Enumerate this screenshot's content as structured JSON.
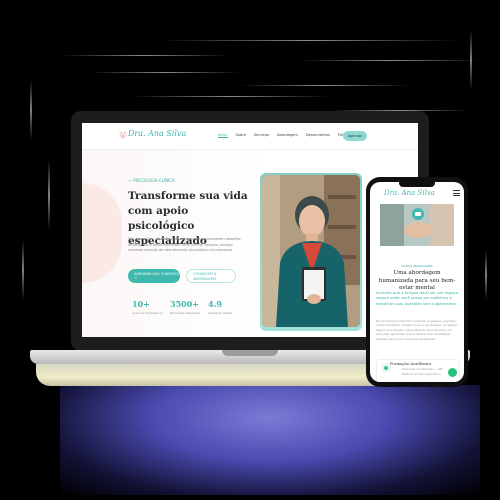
{
  "laptop_site": {
    "logo": "Dra. Ana Silva",
    "nav": {
      "items": [
        "Início",
        "Sobre",
        "Serviços",
        "Abordagem",
        "Depoimentos",
        "FAQ"
      ],
      "cta": "Agendar"
    },
    "hero": {
      "eyebrow": "— PSICOLOGIA CLÍNICA",
      "title": "Transforme sua vida com apoio psicológico especializado",
      "text": "Olá, sou a Dra. Ana Silva. Ajudo pessoas a superarem desafios emocionais e desenvolverem uma melhor relação consigo mesmas através de atendimento psicológico humanizado.",
      "primary_button": "AGENDAR SUA CONSULTA →",
      "secondary_button": "CONHECER A ABORDAGEM"
    },
    "stats": [
      {
        "value": "10+",
        "label": "Anos de Experiência"
      },
      {
        "value": "3500+",
        "label": "Pacientes Atendidos"
      },
      {
        "value": "4.9",
        "label": "Avaliação Média"
      }
    ]
  },
  "phone_site": {
    "logo": "Dra. Ana Silva",
    "eyebrow": "NOSSA ABORDAGEM",
    "title": "Uma abordagem humanizada para seu bem-estar mental",
    "highlight": "Acredito que a terapia deve ser um espaço seguro onde você possa ser autêntico e trabalhar suas questões sem julgamentos.",
    "text": "Na psicologia humanista centrada na pessoa, cognitivo-comportamental, terapia breve e psicanálise, no espaço seguro e acolhedor, personalizado de potencial e de emoções, ajudando você a desenvolver estratégias eficazes para uma vida mais equilibrada.",
    "card": {
      "title": "Formação Acadêmica",
      "items": [
        "Graduação em Psicologia — USP",
        "Mestrado em Psicologia Clínica"
      ]
    }
  },
  "colors": {
    "accent": "#3fb9ae",
    "accent_light": "#8fd9d1",
    "text_dark": "#2b2b2b",
    "blob": "#fbe9e6",
    "whatsapp": "#25c47a"
  }
}
